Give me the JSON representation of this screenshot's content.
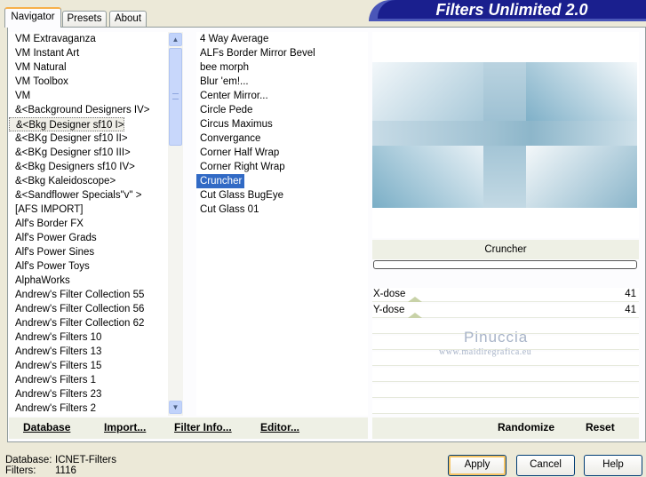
{
  "window": {
    "title": "Filters Unlimited 2.0"
  },
  "tabs": [
    {
      "label": "Navigator",
      "active": true
    },
    {
      "label": "Presets",
      "active": false
    },
    {
      "label": "About",
      "active": false
    }
  ],
  "categories": [
    "VM Extravaganza",
    "VM Instant Art",
    "VM Natural",
    "VM Toolbox",
    "VM",
    "&<Background Designers IV>",
    "&<Bkg Designer sf10 I>",
    "&<BKg Designer sf10 II>",
    "&<BKg Designer sf10 III>",
    "&<Bkg Designers sf10 IV>",
    "&<Bkg Kaleidoscope>",
    "&<Sandflower Specials\"v\" >",
    "[AFS IMPORT]",
    "Alf's Border FX",
    "Alf's Power Grads",
    "Alf's Power Sines",
    "Alf's Power Toys",
    "AlphaWorks",
    "Andrew's Filter Collection 55",
    "Andrew's Filter Collection 56",
    "Andrew's Filter Collection 62",
    "Andrew's Filters 10",
    "Andrew's Filters 13",
    "Andrew's Filters 15",
    "Andrew's Filters 1",
    "Andrew's Filters 23",
    "Andrew's Filters 2"
  ],
  "selected_category_index": 6,
  "effects": [
    "4 Way Average",
    "ALFs Border Mirror Bevel",
    "bee morph",
    "Blur 'em!...",
    "Center Mirror...",
    "Circle Pede",
    "Circus Maximus",
    "Convergance",
    "Corner Half Wrap",
    "Corner Right Wrap",
    "Cruncher",
    "Cut Glass  BugEye",
    "Cut Glass 01"
  ],
  "selected_effect_index": 10,
  "selected_filter_name": "Cruncher",
  "parameters": [
    {
      "label": "X-dose",
      "value": "41"
    },
    {
      "label": "Y-dose",
      "value": "41"
    }
  ],
  "progress_fraction": 0.0,
  "watermark": {
    "name": "Pinuccia",
    "url": "www.maidiregrafica.eu"
  },
  "toolbar": {
    "database": "Database",
    "import": "Import...",
    "filter_info": "Filter Info...",
    "editor": "Editor...",
    "randomize": "Randomize",
    "reset": "Reset"
  },
  "status": {
    "database_label": "Database:",
    "database_value": "ICNET-Filters",
    "filters_label": "Filters:",
    "filters_value": "1116"
  },
  "buttons": {
    "apply": "Apply",
    "cancel": "Cancel",
    "help": "Help"
  },
  "colors": {
    "banner": "#1a1f8e",
    "selection": "#316ac5",
    "preview_base": "#d8e6ee"
  }
}
